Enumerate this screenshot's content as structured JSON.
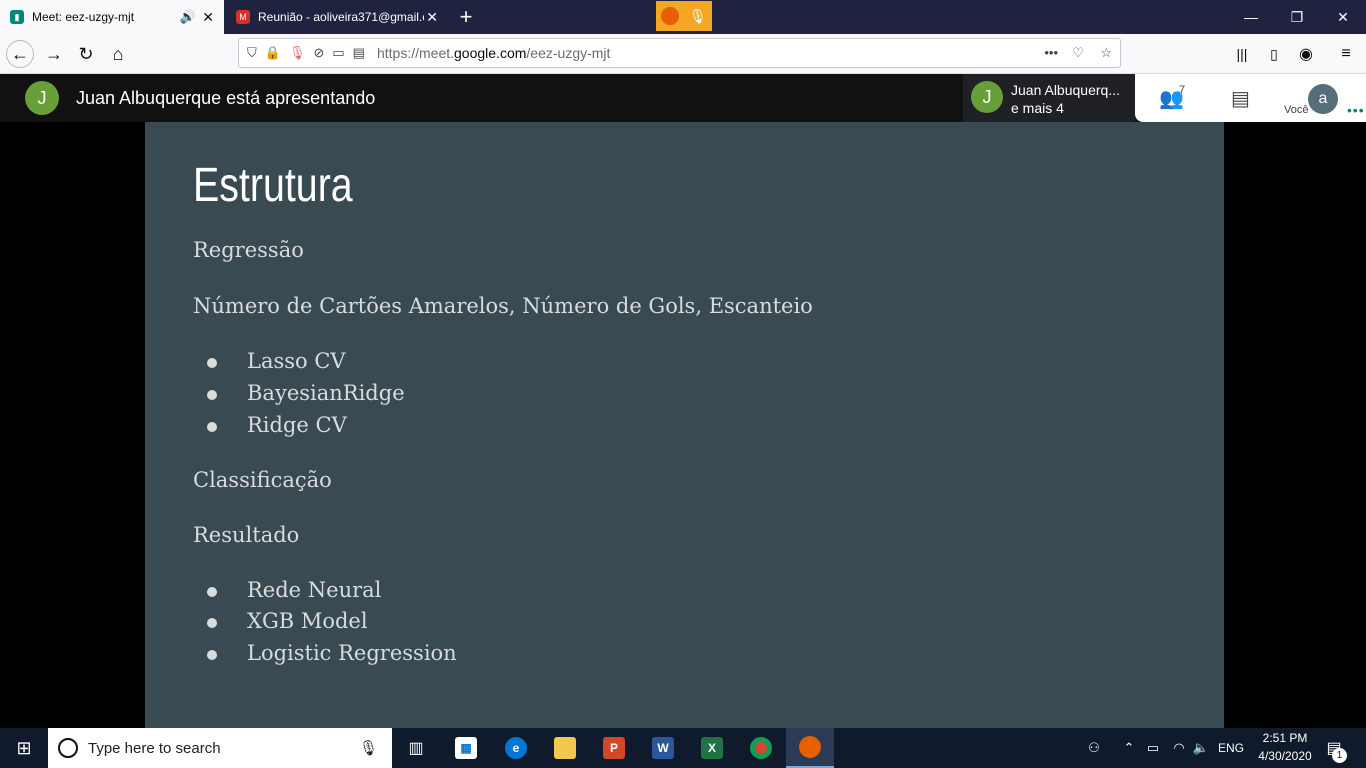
{
  "browser": {
    "tabs": [
      {
        "title": "Meet: eez-uzgy-mjt",
        "favicon": "meet-icon",
        "active": true
      },
      {
        "title": "Reunião - aoliveira371@gmail.c",
        "favicon": "gmail-icon",
        "active": false
      }
    ],
    "url_prefix": "https://meet.",
    "url_domain": "google.com",
    "url_path": "/eez-uzgy-mjt"
  },
  "meet": {
    "presenter_initial": "J",
    "presenting_text": "Juan Albuquerque está apresentando",
    "presenter_name": "Juan Albuquerq...",
    "presenter_more": "e mais 4",
    "participants_count": "7",
    "self_label": "Você",
    "self_initial": "a"
  },
  "slide": {
    "title": "Estrutura",
    "sections": [
      {
        "heading": "Regressão"
      },
      {
        "heading": "Número de Cartões Amarelos, Número de Gols, Escanteio",
        "bullets": [
          "Lasso CV",
          "BayesianRidge",
          "Ridge CV"
        ]
      },
      {
        "heading": "Classificação"
      },
      {
        "heading": "Resultado",
        "bullets": [
          "Rede Neural",
          "XGB Model",
          "Logistic Regression"
        ]
      }
    ]
  },
  "taskbar": {
    "search_placeholder": "Type here to search",
    "language": "ENG",
    "time": "2:51 PM",
    "date": "4/30/2020",
    "notification_count": "1"
  },
  "colors": {
    "tabbar_bg": "#202340",
    "slide_bg": "#3a4a52",
    "avatar_green": "#689f38",
    "taskbar_bg": "#101a2d"
  }
}
